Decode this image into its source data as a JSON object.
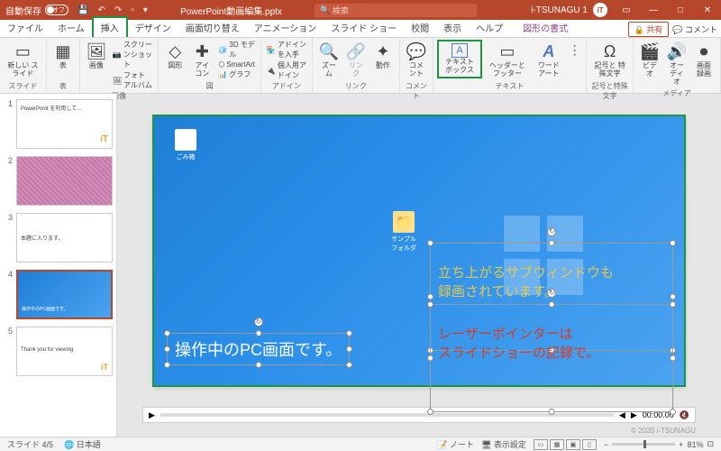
{
  "title": {
    "autosave": "自動保存",
    "off": "オフ",
    "doc": "PowerPoint動画編集.pptx",
    "search": "検索",
    "user": "i-TSUNAGU 1"
  },
  "tabs": {
    "file": "ファイル",
    "home": "ホーム",
    "insert": "挿入",
    "design": "デザイン",
    "transitions": "画面切り替え",
    "animations": "アニメーション",
    "slideshow": "スライド ショー",
    "review": "校閲",
    "view": "表示",
    "help": "ヘルプ",
    "context": "図形の書式",
    "share": "共有",
    "comment": "コメント"
  },
  "ribbon": {
    "newslide": "新しい\nスライド",
    "slides": "スライド",
    "table": "表",
    "tables": "表",
    "image": "画像",
    "screenshot": "スクリーンショット",
    "photoalbum": "フォト アルバム",
    "images": "画像",
    "shapes": "図形",
    "icons": "アイ\nコン",
    "model3d": "3D モデル",
    "smartart": "SmartArt",
    "chart": "グラフ",
    "illust": "図",
    "addins": "アドインを入手",
    "myaddins": "個人用アドイン",
    "addinsgrp": "アドイン",
    "zoom": "ズー\nム",
    "link": "リン\nク",
    "action": "動作",
    "links": "リンク",
    "comment": "コメント",
    "comments": "コメント",
    "textbox": "テキスト\nボックス",
    "headerfooter": "ヘッダーと\nフッター",
    "wordart": "ワード\nアート",
    "text": "テキスト",
    "symbol": "記号と\n特殊文字",
    "symbols": "記号と特殊文字",
    "video": "ビデオ",
    "audio": "オーディオ",
    "screenrec": "画面\n録画",
    "media": "メディア"
  },
  "thumbs": [
    {
      "n": "1",
      "content": "PowerPoint を利用して…"
    },
    {
      "n": "2",
      "content": ""
    },
    {
      "n": "3",
      "content": "本題に入ります。"
    },
    {
      "n": "4",
      "content": "操作中のPC画面です。"
    },
    {
      "n": "5",
      "content": "Thank you for viewing"
    }
  ],
  "slide": {
    "icon1": "ごみ箱",
    "icon2": "サンプルフォルダ",
    "tb1": "立ち上がるサブウィンドウも\n録画されています。",
    "tb2": "レーザーポインターは\nスライドショーの記録で。",
    "tb3": "操作中のPC画面です。"
  },
  "playbar": {
    "time": "00:00.00"
  },
  "copyright": "© 2020 i-TSUNAGU",
  "status": {
    "slide": "スライド 4/5",
    "lang": "日本語",
    "notes": "ノート",
    "display": "表示設定",
    "zoom": "81%"
  }
}
